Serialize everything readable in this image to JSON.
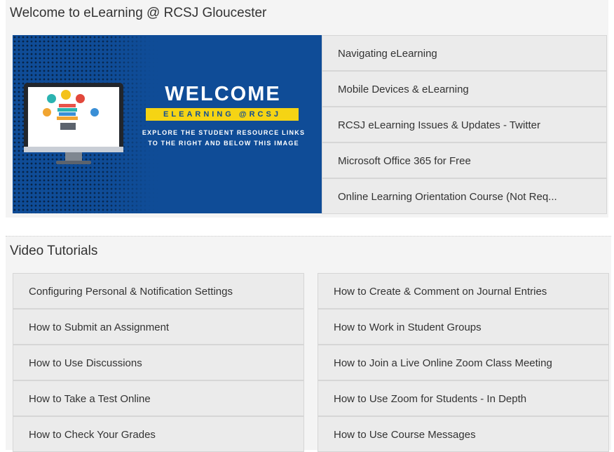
{
  "welcome_module": {
    "title": "Welcome to eLearning @ RCSJ Gloucester",
    "banner": {
      "headline": "WELCOME",
      "tagline": "ELEARNING @RCSJ",
      "explore_line1": "EXPLORE THE STUDENT RESOURCE LINKS",
      "explore_line2": "TO THE RIGHT AND BELOW THIS IMAGE",
      "colors": {
        "background": "#0f4c97",
        "tagline_bg": "#f5d414"
      }
    },
    "links": [
      "Navigating eLearning",
      "Mobile Devices & eLearning",
      "RCSJ eLearning Issues & Updates - Twitter",
      "Microsoft Office 365 for Free",
      "Online Learning Orientation Course (Not Req..."
    ]
  },
  "video_tutorials": {
    "title": "Video Tutorials",
    "left_column": [
      "Configuring Personal & Notification Settings",
      "How to Submit an Assignment",
      "How to Use Discussions",
      "How to Take a Test Online",
      "How to Check Your Grades"
    ],
    "right_column": [
      "How to Create & Comment on Journal Entries",
      "How to Work in Student Groups",
      "How to Join a Live Online Zoom Class Meeting",
      "How to Use Zoom for Students - In Depth",
      "How to Use Course Messages"
    ]
  }
}
